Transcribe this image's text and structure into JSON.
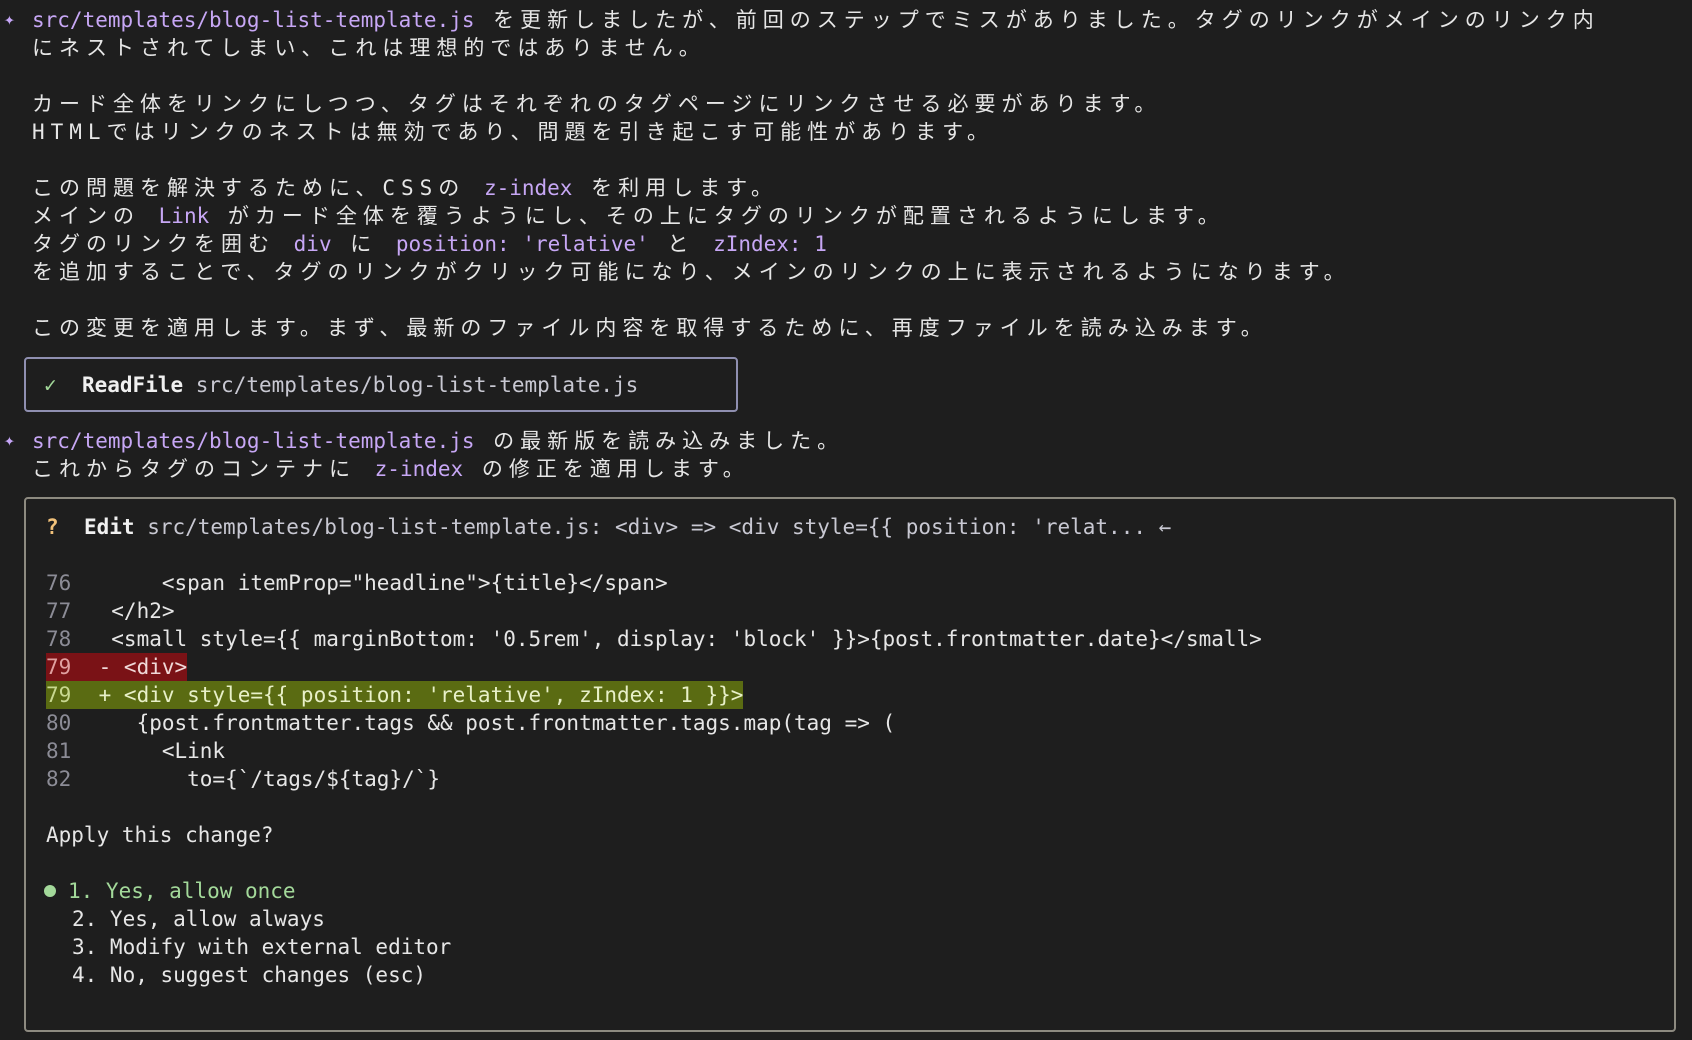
{
  "message1": {
    "file": "src/templates/blog-list-template.js",
    "line1_rest": " を更新しましたが、前回のステップでミスがありました。タグのリンクがメインのリンク内",
    "line2": "にネストされてしまい、これは理想的ではありません。",
    "line3": "カード全体をリンクにしつつ、タグはそれぞれのタグページにリンクさせる必要があります。",
    "line4": "HTMLではリンクのネストは無効であり、問題を引き起こす可能性があります。",
    "line5_a": "この問題を解決するために、CSSの ",
    "line5_code": "z-index",
    "line5_b": " を利用します。",
    "line6_a": "メインの ",
    "line6_code": "Link",
    "line6_b": " がカード全体を覆うようにし、その上にタグのリンクが配置されるようにします。",
    "line7_a": "タグのリンクを囲む ",
    "line7_code1": "div",
    "line7_b": " に ",
    "line7_code2": "position: 'relative'",
    "line7_c": " と ",
    "line7_code3": "zIndex: 1",
    "line8": "を追加することで、タグのリンクがクリック可能になり、メインのリンクの上に表示されるようになります。",
    "line9": "この変更を適用します。まず、最新のファイル内容を取得するために、再度ファイルを読み込みます。"
  },
  "readfile": {
    "check": "✓",
    "tool": "ReadFile",
    "path": "src/templates/blog-list-template.js"
  },
  "message2": {
    "file": "src/templates/blog-list-template.js",
    "line1_rest": " の最新版を読み込みました。",
    "line2_a": "これからタグのコンテナに ",
    "line2_code": "z-index",
    "line2_b": " の修正を適用します。"
  },
  "edit": {
    "q": "?",
    "tool": "Edit",
    "summary": "src/templates/blog-list-template.js: <div> => <div style={{ position: 'relat... ←",
    "code": [
      {
        "num": "76",
        "text": "      <span itemProp=\"headline\">{title}</span>"
      },
      {
        "num": "77",
        "text": "  </h2>"
      },
      {
        "num": "78",
        "text": "  <small style={{ marginBottom: '0.5rem', display: 'block' }}>{post.frontmatter.date}</small>"
      },
      {
        "num": "79",
        "text": " - <div>"
      },
      {
        "num": "79",
        "text": " + <div style={{ position: 'relative', zIndex: 1 }}>"
      },
      {
        "num": "80",
        "text": "    {post.frontmatter.tags && post.frontmatter.tags.map(tag => ("
      },
      {
        "num": "81",
        "text": "      <Link"
      },
      {
        "num": "82",
        "text": "        to={`/tags/${tag}/`}"
      }
    ],
    "prompt": "Apply this change?",
    "options": [
      "1. Yes, allow once",
      "2. Yes, allow always",
      "3. Modify with external editor",
      "4. No, suggest changes (esc)"
    ]
  }
}
